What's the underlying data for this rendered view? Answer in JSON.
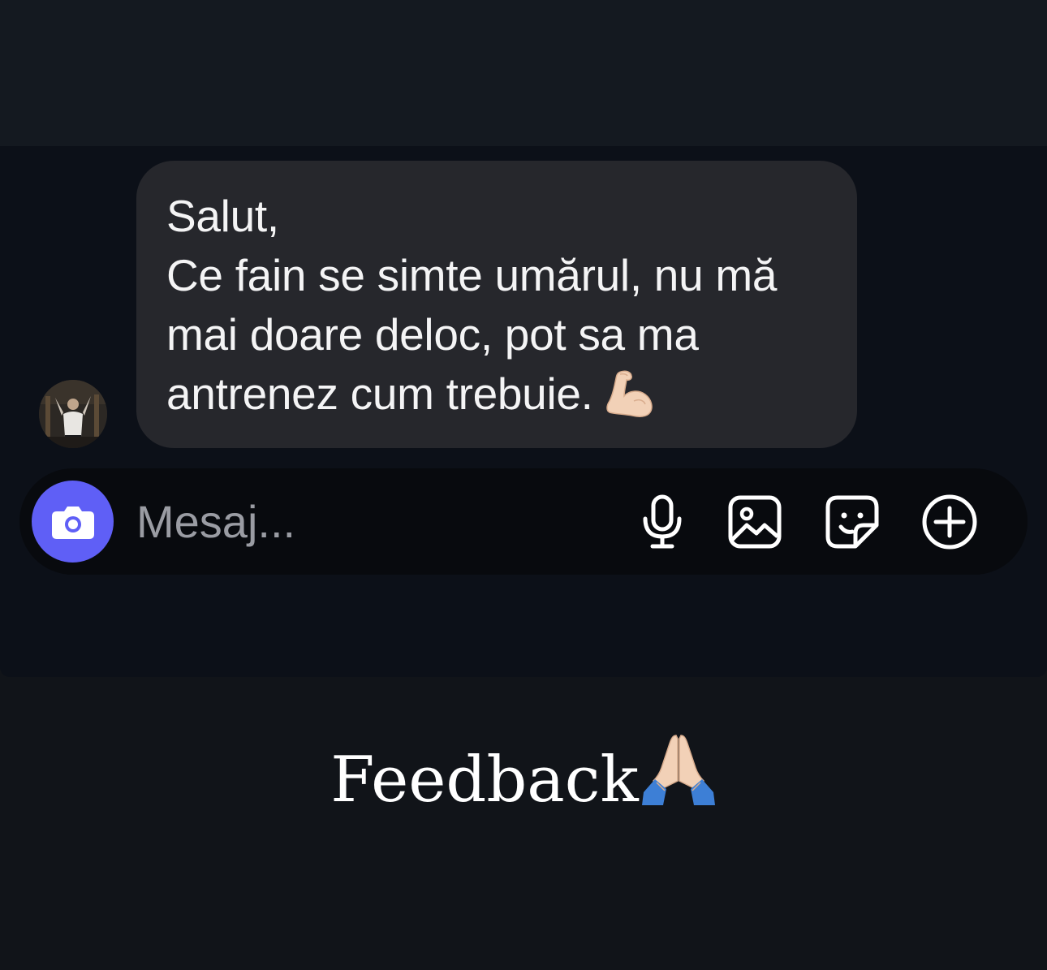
{
  "message": {
    "lines": [
      "Salut,",
      "Ce fain se simte umărul, nu mă",
      "mai doare deloc, pot sa ma",
      "antrenez cum trebuie."
    ],
    "trailing_emoji": "flexed-biceps-emoji"
  },
  "composer": {
    "placeholder": "Mesaj...",
    "camera_icon": "camera-icon",
    "accent_color": "#5f5ff6",
    "actions": [
      "microphone-icon",
      "gallery-icon",
      "sticker-icon",
      "plus-circle-icon"
    ]
  },
  "caption": {
    "text": "Feedback",
    "emoji": "folded-hands-emoji"
  }
}
